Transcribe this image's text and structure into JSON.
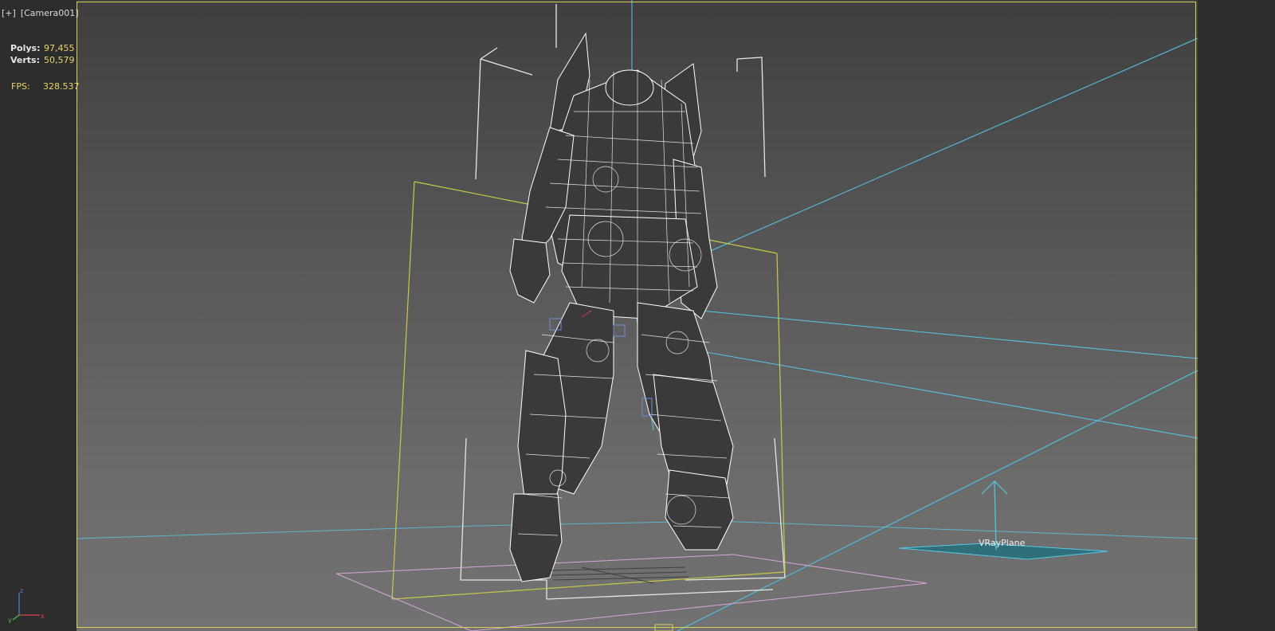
{
  "viewport": {
    "menu_label": "[+]",
    "camera_label": "[Camera001]",
    "stats": {
      "polys_label": "Polys:",
      "polys_value": "97,455",
      "verts_label": "Verts:",
      "verts_value": "50,579",
      "fps_label": "FPS:",
      "fps_value": "328.537"
    },
    "object_label": "VRayPlane"
  },
  "colors": {
    "viewport_border": "#d9cf55",
    "stats_value": "#e8d36a",
    "camera_lines": "#55c8e6",
    "bounding_box": "#c9c94a",
    "ground_grid": "#d9a6d9",
    "wireframe": "#ffffff"
  },
  "icons": {
    "axis": "axis-tripod-icon"
  }
}
